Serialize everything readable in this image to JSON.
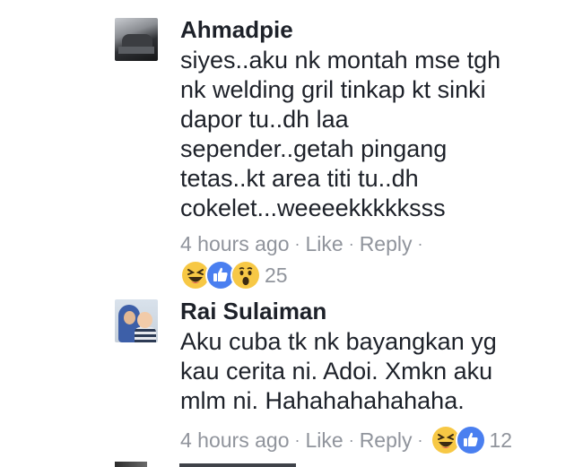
{
  "comments": [
    {
      "author": "Ahmadpie",
      "text": "siyes..aku nk montah mse tgh\nnk welding gril tinkap kt sinki\ndapor tu..dh laa\nsepender..getah pingang\ntetas..kt area titi tu..dh\ncokelet...weeeekkkkksss",
      "time": "4 hours ago",
      "like": "Like",
      "reply": "Reply",
      "reactions": [
        "haha-icon",
        "like-icon",
        "wow-icon"
      ],
      "reaction_count": "25"
    },
    {
      "author": "Rai Sulaiman",
      "text": "Aku cuba tk nk bayangkan yg\nkau cerita ni. Adoi. Xmkn aku\nmlm ni. Hahahahahahaha.",
      "time": "4 hours ago",
      "like": "Like",
      "reply": "Reply",
      "reactions": [
        "haha-icon",
        "like-icon"
      ],
      "reaction_count": "12"
    }
  ],
  "separator": "·",
  "colors": {
    "text": "#1d2129",
    "meta": "#90949c",
    "like_blue": "#4a7ff0",
    "emoji_yellow": "#f7c845"
  }
}
